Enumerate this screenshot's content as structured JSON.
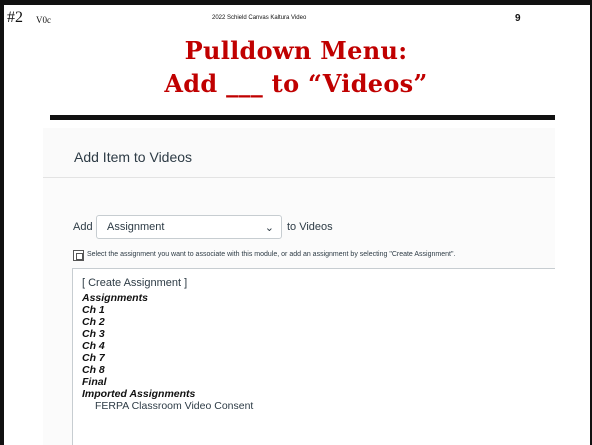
{
  "slide": {
    "number_left": "#2",
    "version": "V0c",
    "header_center": "2022 Schield Canvas Kaltura Video",
    "page_number": "9",
    "title_line1": "Pulldown Menu:",
    "title_line2": "Add ___ to “Videos”"
  },
  "dialog": {
    "title": "Add Item to Videos",
    "add_label": "Add",
    "select_value": "Assignment",
    "to_label": "to Videos",
    "help_text": "Select the assignment you want to associate with this module, or add an assignment by selecting \"Create Assignment\".",
    "list": {
      "create": "[ Create Assignment ]",
      "items": [
        "Assignments",
        "Ch 1",
        "Ch 2",
        "Ch 3",
        "Ch 4",
        "Ch 7",
        "Ch 8",
        "Final",
        "Imported Assignments"
      ],
      "cut_item": "FERPA Classroom Video Consent"
    }
  },
  "colors": {
    "title": "#c00000",
    "frame": "#111111",
    "canvas_text": "#2d3b45"
  },
  "icons": {
    "caret": "chevron-down-icon",
    "help": "module-item-icon"
  }
}
